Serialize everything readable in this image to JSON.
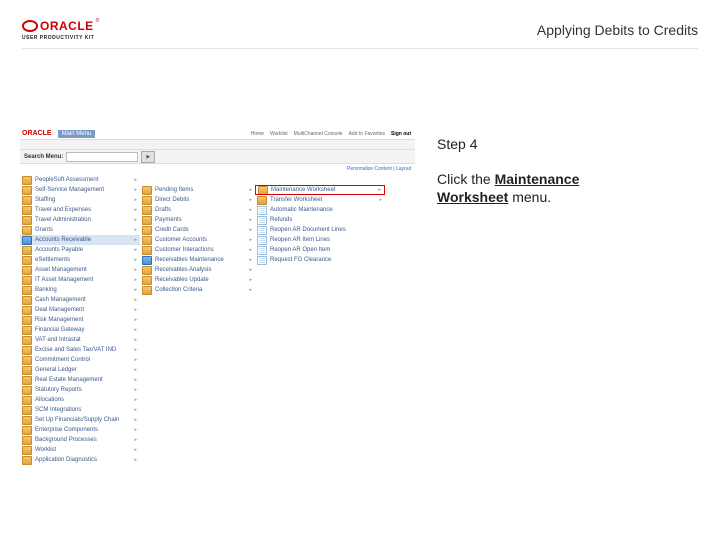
{
  "header": {
    "brand_text": "ORACLE",
    "brand_sub": "USER PRODUCTIVITY KIT",
    "doc_title": "Applying Debits to Credits"
  },
  "instruction": {
    "step_label": "Step 4",
    "text_before": "Click the ",
    "text_link": "Maintenance Worksheet",
    "text_after": " menu."
  },
  "app": {
    "welcome": "Main Menu",
    "top_links": [
      "Home",
      "Worklist",
      "MultiChannel Console",
      "Add to Favorites",
      "Sign out"
    ],
    "breadcrumb": "",
    "search_label": "Search Menu:",
    "search_go": "▶",
    "personalize": "Personalize Content  |  Layout",
    "col1": [
      {
        "icon": "folder",
        "label": "PeopleSoft Assessment",
        "arrow": true
      },
      {
        "icon": "folder",
        "label": "Self-Service Management",
        "arrow": true
      },
      {
        "icon": "folder",
        "label": "Staffing",
        "arrow": true
      },
      {
        "icon": "folder",
        "label": "Travel and Expenses",
        "arrow": true
      },
      {
        "icon": "folder",
        "label": "Travel Administration",
        "arrow": true
      },
      {
        "icon": "folder",
        "label": "Grants",
        "arrow": true
      },
      {
        "icon": "folder-open",
        "label": "Accounts Receivable",
        "arrow": true,
        "selected": true
      },
      {
        "icon": "folder",
        "label": "Accounts Payable",
        "arrow": true
      },
      {
        "icon": "folder",
        "label": "eSettlements",
        "arrow": true
      },
      {
        "icon": "folder",
        "label": "Asset Management",
        "arrow": true
      },
      {
        "icon": "folder",
        "label": "IT Asset Management",
        "arrow": true
      },
      {
        "icon": "folder",
        "label": "Banking",
        "arrow": true
      },
      {
        "icon": "folder",
        "label": "Cash Management",
        "arrow": true
      },
      {
        "icon": "folder",
        "label": "Deal Management",
        "arrow": true
      },
      {
        "icon": "folder",
        "label": "Risk Management",
        "arrow": true
      },
      {
        "icon": "folder",
        "label": "Financial Gateway",
        "arrow": true
      },
      {
        "icon": "folder",
        "label": "VAT and Intrastat",
        "arrow": true
      },
      {
        "icon": "folder",
        "label": "Excise and Sales Tax/VAT IND",
        "arrow": true
      },
      {
        "icon": "folder",
        "label": "Commitment Control",
        "arrow": true
      },
      {
        "icon": "folder",
        "label": "General Ledger",
        "arrow": true
      },
      {
        "icon": "folder",
        "label": "Real Estate Management",
        "arrow": true
      },
      {
        "icon": "folder",
        "label": "Statutory Reports",
        "arrow": true
      },
      {
        "icon": "folder",
        "label": "Allocations",
        "arrow": true
      },
      {
        "icon": "folder",
        "label": "SCM Integrations",
        "arrow": true
      },
      {
        "icon": "folder",
        "label": "Set Up Financials/Supply Chain",
        "arrow": true
      },
      {
        "icon": "folder",
        "label": "Enterprise Components",
        "arrow": true
      },
      {
        "icon": "folder",
        "label": "Background Processes",
        "arrow": true
      },
      {
        "icon": "folder",
        "label": "Worklist",
        "arrow": true
      },
      {
        "icon": "folder",
        "label": "Application Diagnostics",
        "arrow": true
      }
    ],
    "col2": [
      {
        "icon": "none",
        "label": " "
      },
      {
        "icon": "folder",
        "label": "Pending Items",
        "arrow": true
      },
      {
        "icon": "folder",
        "label": "Direct Debits",
        "arrow": true
      },
      {
        "icon": "folder",
        "label": "Drafts",
        "arrow": true
      },
      {
        "icon": "folder",
        "label": "Payments",
        "arrow": true
      },
      {
        "icon": "folder",
        "label": "Credit Cards",
        "arrow": true
      },
      {
        "icon": "folder",
        "label": "Customer Accounts",
        "arrow": true
      },
      {
        "icon": "folder",
        "label": "Customer Interactions",
        "arrow": true
      },
      {
        "icon": "folder-open",
        "label": "Receivables Maintenance",
        "arrow": true
      },
      {
        "icon": "folder",
        "label": "Receivables Analysis",
        "arrow": true
      },
      {
        "icon": "folder",
        "label": "Receivables Update",
        "arrow": true
      },
      {
        "icon": "folder",
        "label": "Collection Criteria",
        "arrow": true
      }
    ],
    "col3": [
      {
        "icon": "none",
        "label": " "
      },
      {
        "icon": "folder",
        "label": "Maintenance Worksheet",
        "arrow": true,
        "highlight": true
      },
      {
        "icon": "folder",
        "label": "Transfer Worksheet",
        "arrow": true
      },
      {
        "icon": "page",
        "label": "Automatic Maintenance"
      },
      {
        "icon": "page",
        "label": "Refunds"
      },
      {
        "icon": "page",
        "label": "Reopen AR Document Lines"
      },
      {
        "icon": "page",
        "label": "Reopen AR Item Lines"
      },
      {
        "icon": "page",
        "label": "Reopen AR Open Item"
      },
      {
        "icon": "page",
        "label": "Request FG Clearance"
      }
    ]
  }
}
